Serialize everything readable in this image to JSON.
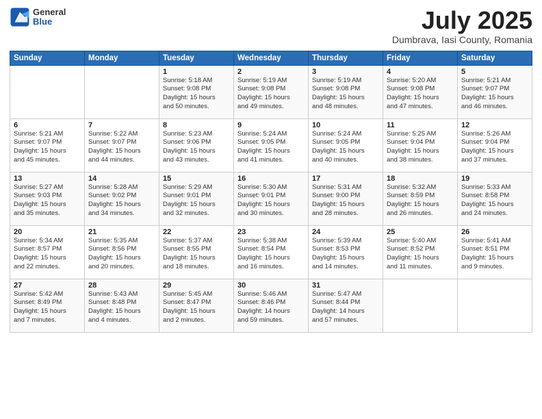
{
  "header": {
    "logo_general": "General",
    "logo_blue": "Blue",
    "month_title": "July 2025",
    "location": "Dumbrava, Iasi County, Romania"
  },
  "weekdays": [
    "Sunday",
    "Monday",
    "Tuesday",
    "Wednesday",
    "Thursday",
    "Friday",
    "Saturday"
  ],
  "rows": [
    [
      {
        "day": "",
        "info": ""
      },
      {
        "day": "",
        "info": ""
      },
      {
        "day": "1",
        "info": "Sunrise: 5:18 AM\nSunset: 9:08 PM\nDaylight: 15 hours\nand 50 minutes."
      },
      {
        "day": "2",
        "info": "Sunrise: 5:19 AM\nSunset: 9:08 PM\nDaylight: 15 hours\nand 49 minutes."
      },
      {
        "day": "3",
        "info": "Sunrise: 5:19 AM\nSunset: 9:08 PM\nDaylight: 15 hours\nand 48 minutes."
      },
      {
        "day": "4",
        "info": "Sunrise: 5:20 AM\nSunset: 9:08 PM\nDaylight: 15 hours\nand 47 minutes."
      },
      {
        "day": "5",
        "info": "Sunrise: 5:21 AM\nSunset: 9:07 PM\nDaylight: 15 hours\nand 46 minutes."
      }
    ],
    [
      {
        "day": "6",
        "info": "Sunrise: 5:21 AM\nSunset: 9:07 PM\nDaylight: 15 hours\nand 45 minutes."
      },
      {
        "day": "7",
        "info": "Sunrise: 5:22 AM\nSunset: 9:07 PM\nDaylight: 15 hours\nand 44 minutes."
      },
      {
        "day": "8",
        "info": "Sunrise: 5:23 AM\nSunset: 9:06 PM\nDaylight: 15 hours\nand 43 minutes."
      },
      {
        "day": "9",
        "info": "Sunrise: 5:24 AM\nSunset: 9:05 PM\nDaylight: 15 hours\nand 41 minutes."
      },
      {
        "day": "10",
        "info": "Sunrise: 5:24 AM\nSunset: 9:05 PM\nDaylight: 15 hours\nand 40 minutes."
      },
      {
        "day": "11",
        "info": "Sunrise: 5:25 AM\nSunset: 9:04 PM\nDaylight: 15 hours\nand 38 minutes."
      },
      {
        "day": "12",
        "info": "Sunrise: 5:26 AM\nSunset: 9:04 PM\nDaylight: 15 hours\nand 37 minutes."
      }
    ],
    [
      {
        "day": "13",
        "info": "Sunrise: 5:27 AM\nSunset: 9:03 PM\nDaylight: 15 hours\nand 35 minutes."
      },
      {
        "day": "14",
        "info": "Sunrise: 5:28 AM\nSunset: 9:02 PM\nDaylight: 15 hours\nand 34 minutes."
      },
      {
        "day": "15",
        "info": "Sunrise: 5:29 AM\nSunset: 9:01 PM\nDaylight: 15 hours\nand 32 minutes."
      },
      {
        "day": "16",
        "info": "Sunrise: 5:30 AM\nSunset: 9:01 PM\nDaylight: 15 hours\nand 30 minutes."
      },
      {
        "day": "17",
        "info": "Sunrise: 5:31 AM\nSunset: 9:00 PM\nDaylight: 15 hours\nand 28 minutes."
      },
      {
        "day": "18",
        "info": "Sunrise: 5:32 AM\nSunset: 8:59 PM\nDaylight: 15 hours\nand 26 minutes."
      },
      {
        "day": "19",
        "info": "Sunrise: 5:33 AM\nSunset: 8:58 PM\nDaylight: 15 hours\nand 24 minutes."
      }
    ],
    [
      {
        "day": "20",
        "info": "Sunrise: 5:34 AM\nSunset: 8:57 PM\nDaylight: 15 hours\nand 22 minutes."
      },
      {
        "day": "21",
        "info": "Sunrise: 5:35 AM\nSunset: 8:56 PM\nDaylight: 15 hours\nand 20 minutes."
      },
      {
        "day": "22",
        "info": "Sunrise: 5:37 AM\nSunset: 8:55 PM\nDaylight: 15 hours\nand 18 minutes."
      },
      {
        "day": "23",
        "info": "Sunrise: 5:38 AM\nSunset: 8:54 PM\nDaylight: 15 hours\nand 16 minutes."
      },
      {
        "day": "24",
        "info": "Sunrise: 5:39 AM\nSunset: 8:53 PM\nDaylight: 15 hours\nand 14 minutes."
      },
      {
        "day": "25",
        "info": "Sunrise: 5:40 AM\nSunset: 8:52 PM\nDaylight: 15 hours\nand 11 minutes."
      },
      {
        "day": "26",
        "info": "Sunrise: 5:41 AM\nSunset: 8:51 PM\nDaylight: 15 hours\nand 9 minutes."
      }
    ],
    [
      {
        "day": "27",
        "info": "Sunrise: 5:42 AM\nSunset: 8:49 PM\nDaylight: 15 hours\nand 7 minutes."
      },
      {
        "day": "28",
        "info": "Sunrise: 5:43 AM\nSunset: 8:48 PM\nDaylight: 15 hours\nand 4 minutes."
      },
      {
        "day": "29",
        "info": "Sunrise: 5:45 AM\nSunset: 8:47 PM\nDaylight: 15 hours\nand 2 minutes."
      },
      {
        "day": "30",
        "info": "Sunrise: 5:46 AM\nSunset: 8:46 PM\nDaylight: 14 hours\nand 59 minutes."
      },
      {
        "day": "31",
        "info": "Sunrise: 5:47 AM\nSunset: 8:44 PM\nDaylight: 14 hours\nand 57 minutes."
      },
      {
        "day": "",
        "info": ""
      },
      {
        "day": "",
        "info": ""
      }
    ]
  ]
}
